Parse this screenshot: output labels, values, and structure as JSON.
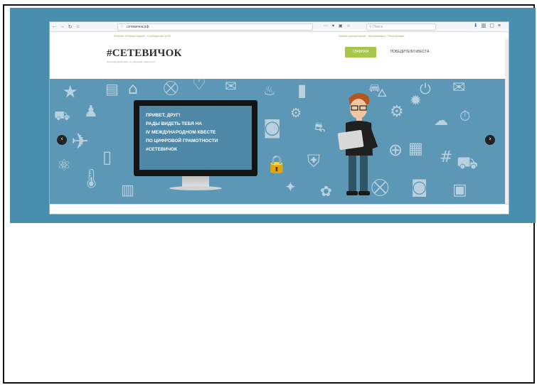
{
  "browser": {
    "nav_icons": [
      "←",
      "→",
      "↻",
      "⌂"
    ],
    "url": "сетевичок.рф",
    "page_actions": "⋯ ♥ ▣ ☆",
    "search_placeholder": "Поиск",
    "right_icons": [
      "⬇",
      "▥",
      "▢",
      "≡"
    ]
  },
  "site": {
    "top_links_left": "Рейтинг Отзывы нашей · Сообщество в VK",
    "top_links_right": "Забыл пароль/логин · Авторизация · Регистрация",
    "logo": "#СЕТЕВИЧОК",
    "logo_sub": "международный квест по цифровой грамотности",
    "nav_home": "ГЛАВНАЯ",
    "nav_winners": "ПОБЕДИТЕЛИ КВЕСТА"
  },
  "hero": {
    "lines": [
      "ПРИВЕТ, ДРУГ!",
      "РАДЫ ВИДЕТЬ ТЕБЯ НА",
      "IV МЕЖДУНАРОДНОМ КВЕСТЕ",
      "ПО ЦИФРОВОЙ ГРАМОТНОСТИ",
      "#СЕТЕВИЧОК"
    ],
    "arrow_left": "‹",
    "arrow_right": "›"
  },
  "colors": {
    "outer_bg": "#4a8eae",
    "hero_bg": "#5d97b6",
    "accent": "#a8c64a"
  }
}
